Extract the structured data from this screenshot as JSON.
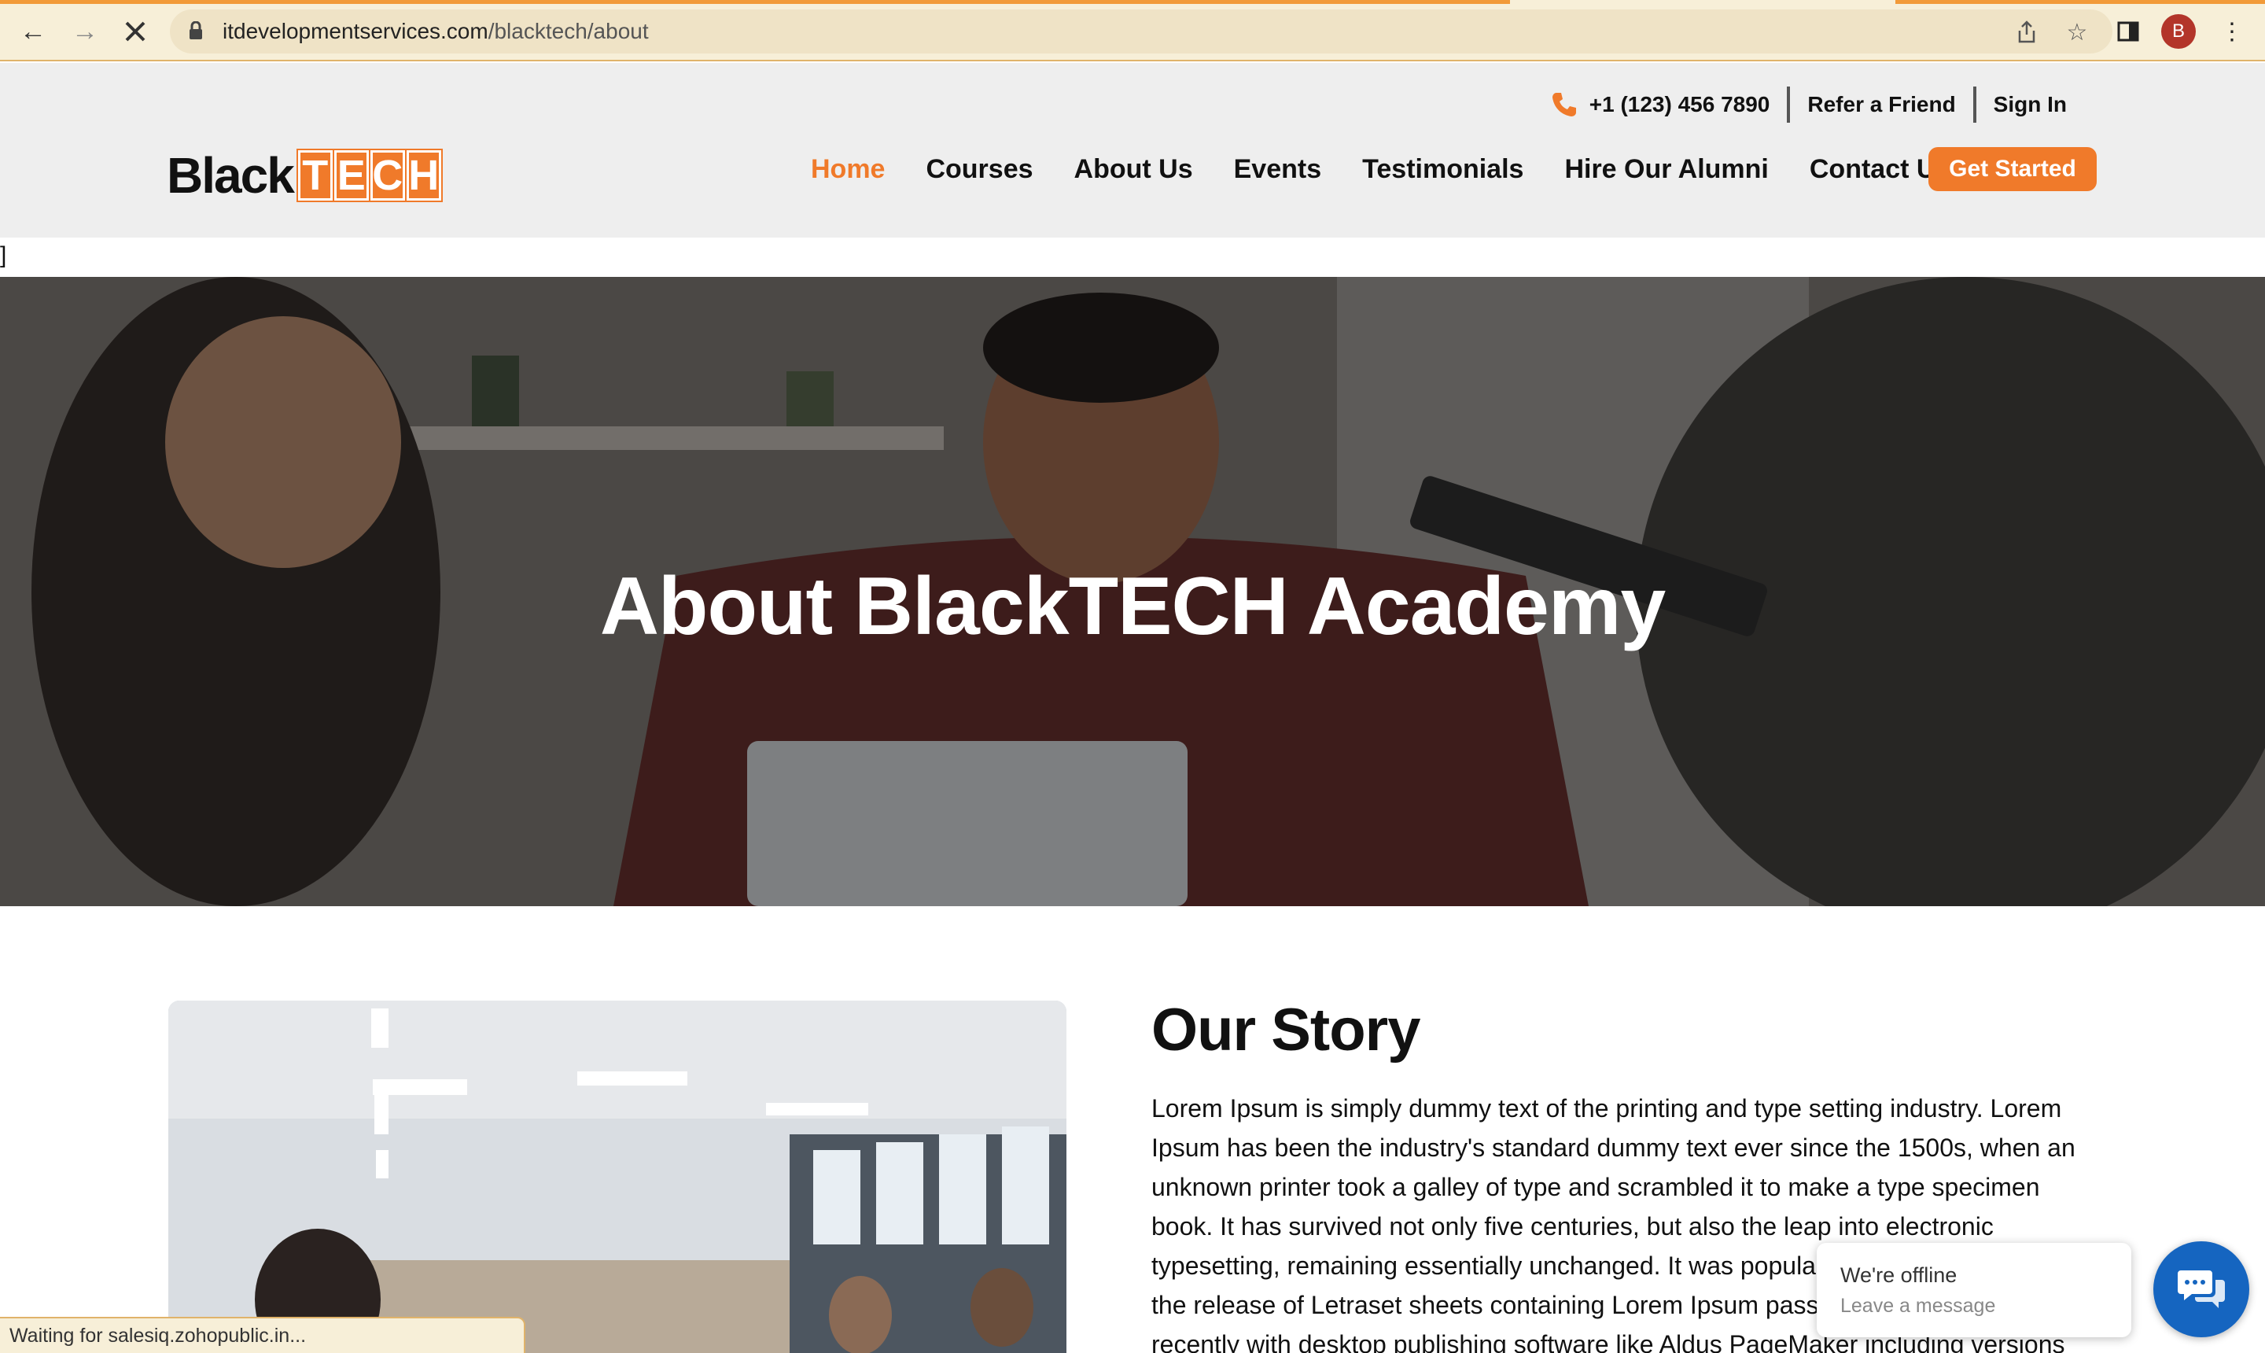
{
  "browser": {
    "url_host": "itdevelopmentservices.com",
    "url_path": "/blacktech/about",
    "profile_initial": "B",
    "status_text": "Waiting for salesiq.zohopublic.in..."
  },
  "header": {
    "phone": "+1 (123) 456 7890",
    "refer_label": "Refer a Friend",
    "signin_label": "Sign In",
    "logo_black": "Black",
    "logo_tech": [
      "T",
      "E",
      "C",
      "H"
    ],
    "nav": [
      "Home",
      "Courses",
      "About Us",
      "Events",
      "Testimonials",
      "Hire Our Alumni",
      "Contact Us"
    ],
    "active_nav": "Home",
    "cta_label": "Get Started",
    "accent_color": "#f07a2a"
  },
  "stray_text": "]",
  "hero": {
    "title": "About BlackTECH Academy"
  },
  "story": {
    "title": "Our Story",
    "body": "Lorem Ipsum is simply dummy text of the printing and type setting industry. Lorem Ipsum has been the industry's standard dummy text ever since the 1500s, when an unknown printer took a galley of type and scrambled it to make a type specimen book. It has survived not only five centuries, but also the leap into electronic typesetting, remaining essentially unchanged. It was popularised in the 1960s with the release of Letraset sheets containing Lorem Ipsum passages, and more recently with desktop publishing software like Aldus PageMaker including versions of Lorem"
  },
  "chat": {
    "status": "We're offline",
    "subtitle": "Leave a message",
    "button_color": "#1565c0"
  }
}
